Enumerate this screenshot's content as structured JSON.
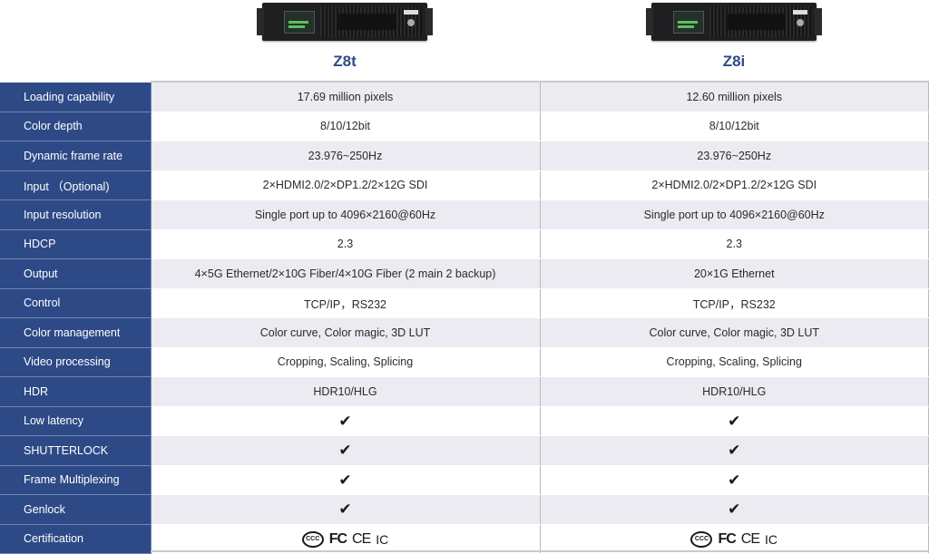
{
  "products": [
    {
      "name": "Z8t",
      "image": "z8t-device-image"
    },
    {
      "name": "Z8i",
      "image": "z8i-device-image"
    }
  ],
  "colors": {
    "label_bg": "#2d4a86",
    "title": "#2f4a8a",
    "stripe": "#ebebf1"
  },
  "rows": [
    {
      "label": "Loading capability",
      "z8t": "17.69 million pixels",
      "z8i": "12.60 million pixels",
      "type": "text"
    },
    {
      "label": "Color depth",
      "z8t": "8/10/12bit",
      "z8i": "8/10/12bit",
      "type": "text"
    },
    {
      "label": "Dynamic frame rate",
      "z8t": "23.976~250Hz",
      "z8i": "23.976~250Hz",
      "type": "text"
    },
    {
      "label": "Input （Optional)",
      "z8t": "2×HDMI2.0/2×DP1.2/2×12G SDI",
      "z8i": "2×HDMI2.0/2×DP1.2/2×12G SDI",
      "type": "text"
    },
    {
      "label": "Input resolution",
      "z8t": "Single port up to 4096×2160@60Hz",
      "z8i": "Single port up to 4096×2160@60Hz",
      "type": "text"
    },
    {
      "label": "HDCP",
      "z8t": "2.3",
      "z8i": "2.3",
      "type": "text"
    },
    {
      "label": "Output",
      "z8t": "4×5G Ethernet/2×10G Fiber/4×10G Fiber (2 main 2 backup)",
      "z8i": "20×1G Ethernet",
      "type": "text"
    },
    {
      "label": "Control",
      "z8t": "TCP/IP，RS232",
      "z8i": "TCP/IP，RS232",
      "type": "text"
    },
    {
      "label": "Color management",
      "z8t": "Color curve, Color magic, 3D LUT",
      "z8i": "Color curve, Color magic, 3D LUT",
      "type": "text"
    },
    {
      "label": "Video processing",
      "z8t": "Cropping, Scaling, Splicing",
      "z8i": "Cropping, Scaling, Splicing",
      "type": "text"
    },
    {
      "label": "HDR",
      "z8t": "HDR10/HLG",
      "z8i": "HDR10/HLG",
      "type": "text"
    },
    {
      "label": "Low latency",
      "z8t": "✔",
      "z8i": "✔",
      "type": "check"
    },
    {
      "label": "SHUTTERLOCK",
      "z8t": "✔",
      "z8i": "✔",
      "type": "check"
    },
    {
      "label": "Frame Multiplexing",
      "z8t": "✔",
      "z8i": "✔",
      "type": "check"
    },
    {
      "label": "Genlock",
      "z8t": "✔",
      "z8i": "✔",
      "type": "check"
    },
    {
      "label": "Certification",
      "z8t": "certs",
      "z8i": "certs",
      "type": "certs"
    }
  ],
  "certifications": {
    "ccc": "CCC",
    "fc": "FC",
    "ce": "CE",
    "ic": "IC"
  },
  "icons": {
    "check": "check-icon"
  }
}
